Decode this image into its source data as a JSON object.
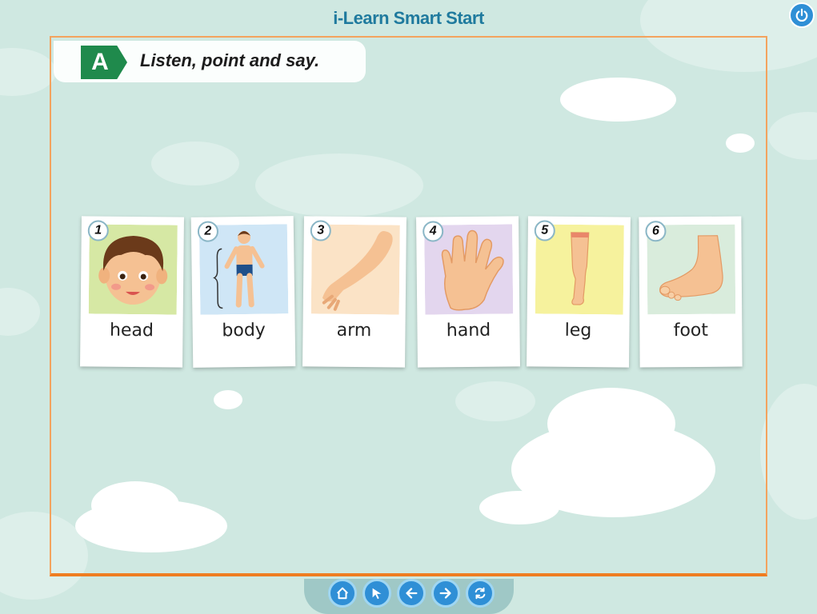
{
  "app": {
    "title": "i-Learn Smart Start"
  },
  "activity": {
    "badge": "A",
    "instruction": "Listen, point and say."
  },
  "cards": [
    {
      "number": "1",
      "word": "head",
      "bg": "#d6e8a4"
    },
    {
      "number": "2",
      "word": "body",
      "bg": "#cfe6f6"
    },
    {
      "number": "3",
      "word": "arm",
      "bg": "#fbe3c6"
    },
    {
      "number": "4",
      "word": "hand",
      "bg": "#e3d6ee"
    },
    {
      "number": "5",
      "word": "leg",
      "bg": "#f6f29d"
    },
    {
      "number": "6",
      "word": "foot",
      "bg": "#d9ecdc"
    }
  ],
  "toolbar": {
    "buttons": [
      "home-icon",
      "pointer-icon",
      "back-arrow-icon",
      "forward-arrow-icon",
      "refresh-icon"
    ]
  },
  "colors": {
    "accent": "#2f8fd6",
    "frame": "#ef7d21",
    "badge": "#1f8a4c",
    "skin": "#f5c193"
  }
}
